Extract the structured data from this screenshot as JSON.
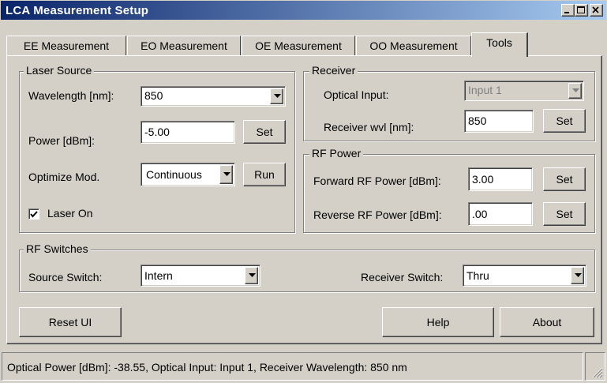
{
  "window": {
    "title": "LCA Measurement Setup"
  },
  "tabs": [
    {
      "label": "EE Measurement"
    },
    {
      "label": "EO Measurement"
    },
    {
      "label": "OE Measurement"
    },
    {
      "label": "OO Measurement"
    },
    {
      "label": "Tools",
      "active": true
    }
  ],
  "laser_source": {
    "title": "Laser Source",
    "wavelength_label": "Wavelength [nm]:",
    "wavelength_value": "850",
    "power_label": "Power [dBm]:",
    "power_value": "-5.00",
    "power_set_label": "Set",
    "optimize_label": "Optimize Mod.",
    "optimize_value": "Continuous",
    "run_label": "Run",
    "laser_on_label": "Laser On",
    "laser_on_checked": true
  },
  "receiver": {
    "title": "Receiver",
    "optical_input_label": "Optical Input:",
    "optical_input_value": "Input 1",
    "wvl_label": "Receiver wvl [nm]:",
    "wvl_value": "850",
    "set_label": "Set"
  },
  "rf_power": {
    "title": "RF Power",
    "forward_label": "Forward RF Power [dBm]:",
    "forward_value": "3.00",
    "forward_set_label": "Set",
    "reverse_label": "Reverse RF Power [dBm]:",
    "reverse_value": ".00",
    "reverse_set_label": "Set"
  },
  "rf_switches": {
    "title": "RF Switches",
    "source_label": "Source Switch:",
    "source_value": "Intern",
    "receiver_label": "Receiver Switch:",
    "receiver_value": "Thru"
  },
  "buttons": {
    "reset_ui": "Reset UI",
    "help": "Help",
    "about": "About"
  },
  "status": {
    "text": "Optical Power [dBm]:  -38.55,  Optical Input:  Input 1, Receiver Wavelength:  850 nm"
  },
  "colors": {
    "face": "#d4d0c8",
    "title_start": "#0a246a",
    "title_end": "#a6caf0"
  },
  "icons": [
    "minimize-icon",
    "maximize-icon",
    "close-icon",
    "dropdown-arrow-icon",
    "checkmark-icon",
    "resize-grip-icon"
  ]
}
